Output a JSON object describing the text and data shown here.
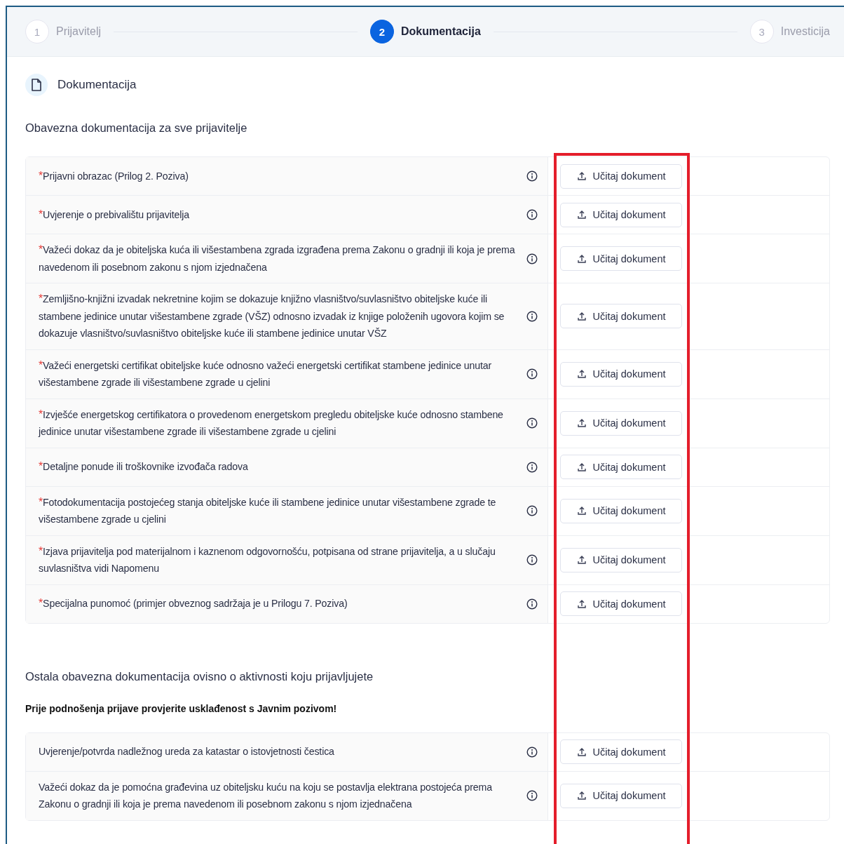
{
  "steps": [
    {
      "number": "1",
      "label": "Prijavitelj",
      "selected": false
    },
    {
      "number": "2",
      "label": "Dokumentacija",
      "selected": true
    },
    {
      "number": "3",
      "label": "Investicija",
      "selected": false
    }
  ],
  "section_title": "Dokumentacija",
  "groups": [
    {
      "title": "Obavezna dokumentacija za sve prijavitelje",
      "rows": [
        {
          "label": "Prijavni obrazac (Prilog 2. Poziva)",
          "marker": "*",
          "button": "Učitaj dokument"
        },
        {
          "label": "Uvjerenje o prebivalištu prijavitelja",
          "marker": "*",
          "button": "Učitaj dokument"
        },
        {
          "label": "Važeći dokaz da je obiteljska kuća ili višestambena zgrada izgrađena prema Zakonu o gradnji ili koja je prema navedenom ili posebnom zakonu s njom izjednačena",
          "marker": "*",
          "button": "Učitaj dokument"
        },
        {
          "label": "Zemljišno-knjižni izvadak nekretnine kojim se dokazuje knjižno vlasništvo/suvlasništvo obiteljske kuće ili stambene jedinice unutar višestambene zgrade (VŠZ) odnosno izvadak iz knjige položenih ugovora kojim se dokazuje vlasništvo/suvlasništvo obiteljske kuće ili stambene jedinice unutar VŠZ",
          "marker": "*",
          "button": "Učitaj dokument"
        },
        {
          "label": "Važeći energetski certifikat obiteljske kuće odnosno važeći energetski certifikat stambene jedinice unutar višestambene zgrade ili višestambene zgrade u cjelini",
          "marker": "*",
          "button": "Učitaj dokument"
        },
        {
          "label": "Izvješće energetskog certifikatora o provedenom energetskom pregledu obiteljske kuće odnosno stambene jedinice unutar višestambene zgrade ili višestambene zgrade u cjelini",
          "marker": "*",
          "button": "Učitaj dokument"
        },
        {
          "label": "Detaljne ponude ili troškovnike izvođača radova",
          "marker": "*",
          "button": "Učitaj dokument"
        },
        {
          "label": "Fotodokumentacija postojećeg stanja obiteljske kuće ili stambene jedinice unutar višestambene zgrade te višestambene zgrade u cjelini",
          "marker": "*",
          "button": "Učitaj dokument"
        },
        {
          "label": "Izjava prijavitelja pod materijalnom i kaznenom odgovornošću, potpisana od strane prijavitelja, a u slučaju suvlasništva vidi Napomenu",
          "marker": "*",
          "button": "Učitaj dokument"
        },
        {
          "label": "Specijalna punomoć (primjer obveznog sadržaja je u Prilogu 7. Poziva)",
          "marker": "*",
          "button": "Učitaj dokument"
        }
      ]
    },
    {
      "title": "Ostala obavezna dokumentacija ovisno o aktivnosti koju prijavljujete",
      "note": "Prije podnošenja prijave provjerite usklađenost s Javnim pozivom!",
      "rows": [
        {
          "label": "Uvjerenje/potvrda nadležnog ureda za katastar o istovjetnosti čestica",
          "button": "Učitaj dokument"
        },
        {
          "label": "Važeći dokaz da je pomoćna građevina uz obiteljsku kuću na koju se postavlja elektrana postojeća prema Zakonu o gradnji ili koja je prema navedenom ili posebnom zakonu s njom izjednačena",
          "button": "Učitaj dokument"
        }
      ]
    }
  ]
}
